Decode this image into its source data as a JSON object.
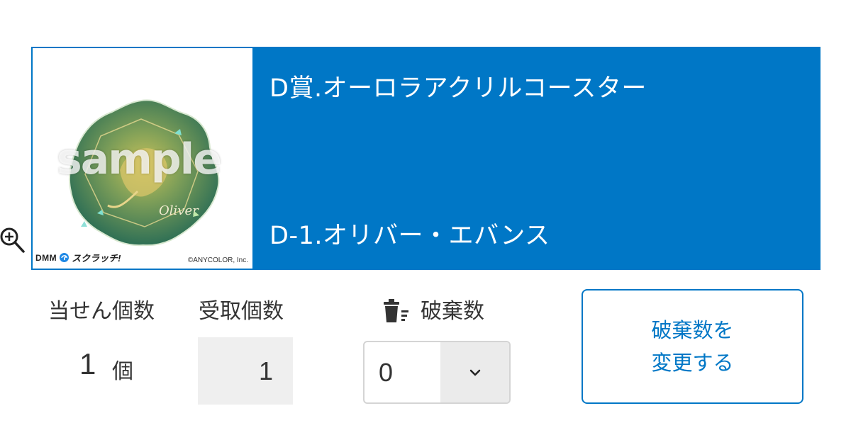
{
  "prize": {
    "title": "D賞.オーロラアクリルコースター",
    "variant": "D-1.オリバー・エバンス",
    "image": {
      "watermark": "sample",
      "coaster_signature": "Oliver",
      "logo_brand": "DMM",
      "logo_text": "スクラッチ!",
      "copyright": "©ANYCOLOR, Inc."
    }
  },
  "quantities": {
    "won_label": "当せん個数",
    "won_value": "1",
    "won_unit": "個",
    "received_label": "受取個数",
    "received_value": "1",
    "discard_label": "破棄数",
    "discard_value": "0"
  },
  "actions": {
    "change_discard_line1": "破棄数を",
    "change_discard_line2": "変更する"
  },
  "icons": {
    "zoom": "zoom-in-icon",
    "trash": "trash-icon",
    "dropdown": "chevron-down-icon"
  },
  "colors": {
    "accent": "#0077c6",
    "field_bg": "#efefef",
    "text": "#333333"
  }
}
